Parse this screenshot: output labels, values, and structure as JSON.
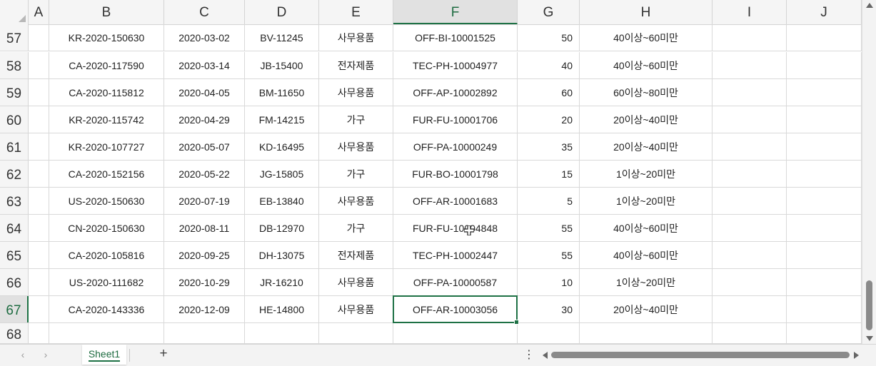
{
  "columns": [
    "A",
    "B",
    "C",
    "D",
    "E",
    "F",
    "G",
    "H",
    "I",
    "J"
  ],
  "selected_column": "F",
  "selected_row": "67",
  "active_cell": "F67",
  "rows": [
    {
      "num": "57",
      "cells": [
        "",
        "KR-2020-150630",
        "2020-03-02",
        "BV-11245",
        "사무용품",
        "OFF-BI-10001525",
        "50",
        "40이상~60미만",
        "",
        ""
      ]
    },
    {
      "num": "58",
      "cells": [
        "",
        "CA-2020-117590",
        "2020-03-14",
        "JB-15400",
        "전자제품",
        "TEC-PH-10004977",
        "40",
        "40이상~60미만",
        "",
        ""
      ]
    },
    {
      "num": "59",
      "cells": [
        "",
        "CA-2020-115812",
        "2020-04-05",
        "BM-11650",
        "사무용품",
        "OFF-AP-10002892",
        "60",
        "60이상~80미만",
        "",
        ""
      ]
    },
    {
      "num": "60",
      "cells": [
        "",
        "KR-2020-115742",
        "2020-04-29",
        "FM-14215",
        "가구",
        "FUR-FU-10001706",
        "20",
        "20이상~40미만",
        "",
        ""
      ]
    },
    {
      "num": "61",
      "cells": [
        "",
        "KR-2020-107727",
        "2020-05-07",
        "KD-16495",
        "사무용품",
        "OFF-PA-10000249",
        "35",
        "20이상~40미만",
        "",
        ""
      ]
    },
    {
      "num": "62",
      "cells": [
        "",
        "CA-2020-152156",
        "2020-05-22",
        "JG-15805",
        "가구",
        "FUR-BO-10001798",
        "15",
        "1이상~20미만",
        "",
        ""
      ]
    },
    {
      "num": "63",
      "cells": [
        "",
        "US-2020-150630",
        "2020-07-19",
        "EB-13840",
        "사무용품",
        "OFF-AR-10001683",
        "5",
        "1이상~20미만",
        "",
        ""
      ]
    },
    {
      "num": "64",
      "cells": [
        "",
        "CN-2020-150630",
        "2020-08-11",
        "DB-12970",
        "가구",
        "FUR-FU-10004848",
        "55",
        "40이상~60미만",
        "",
        ""
      ]
    },
    {
      "num": "65",
      "cells": [
        "",
        "CA-2020-105816",
        "2020-09-25",
        "DH-13075",
        "전자제품",
        "TEC-PH-10002447",
        "55",
        "40이상~60미만",
        "",
        ""
      ]
    },
    {
      "num": "66",
      "cells": [
        "",
        "US-2020-111682",
        "2020-10-29",
        "JR-16210",
        "사무용품",
        "OFF-PA-10000587",
        "10",
        "1이상~20미만",
        "",
        ""
      ]
    },
    {
      "num": "67",
      "cells": [
        "",
        "CA-2020-143336",
        "2020-12-09",
        "HE-14800",
        "사무용품",
        "OFF-AR-10003056",
        "30",
        "20이상~40미만",
        "",
        ""
      ]
    },
    {
      "num": "68",
      "cells": [
        "",
        "",
        "",
        "",
        "",
        "",
        "",
        "",
        "",
        ""
      ]
    }
  ],
  "sheet_tabs": [
    {
      "label": "Sheet1",
      "active": true
    }
  ],
  "icons": {
    "prev_sheet": "chevron-left-icon",
    "next_sheet": "chevron-right-icon",
    "add_sheet": "plus-icon",
    "more": "vertical-ellipsis-icon",
    "cursor": "cell-cursor-icon"
  },
  "labels": {
    "prev": "‹",
    "next": "›",
    "add": "+",
    "more": "⋮"
  },
  "colors": {
    "accent": "#1e7145",
    "header_bg": "#f5f5f5",
    "selected_header_bg": "#e1e1e1",
    "gridline": "#d9d9d9"
  }
}
